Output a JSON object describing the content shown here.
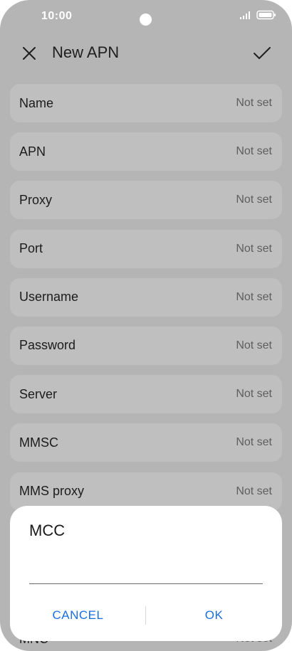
{
  "status_bar": {
    "time": "10:00",
    "icons": [
      "signal-icon",
      "battery-icon"
    ]
  },
  "app_bar": {
    "title": "New APN",
    "close_icon": "close-icon",
    "confirm_icon": "checkmark-icon"
  },
  "fields": [
    {
      "label": "Name",
      "value": "Not set"
    },
    {
      "label": "APN",
      "value": "Not set"
    },
    {
      "label": "Proxy",
      "value": "Not set"
    },
    {
      "label": "Port",
      "value": "Not set"
    },
    {
      "label": "Username",
      "value": "Not set"
    },
    {
      "label": "Password",
      "value": "Not set"
    },
    {
      "label": "Server",
      "value": "Not set"
    },
    {
      "label": "MMSC",
      "value": "Not set"
    },
    {
      "label": "MMS proxy",
      "value": "Not set"
    }
  ],
  "peek_field": {
    "label": "MNC",
    "value": "Not set"
  },
  "dialog": {
    "title": "MCC",
    "input_value": "",
    "cancel_label": "CANCEL",
    "ok_label": "OK"
  },
  "colors": {
    "accent": "#1a6fe0",
    "scrim_background": "#b5b5b5",
    "row_background": "#bfbfbf",
    "dialog_background": "#ffffff"
  }
}
